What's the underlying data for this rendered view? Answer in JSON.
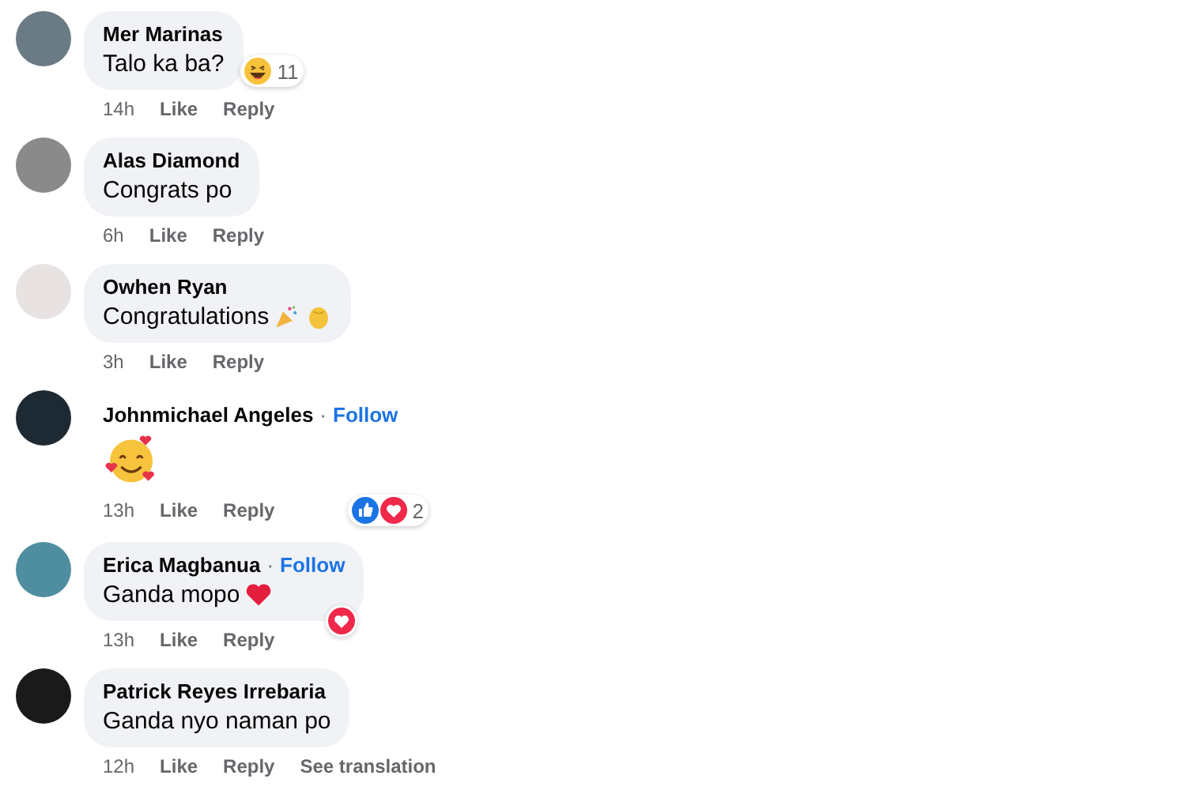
{
  "comments": [
    {
      "kind": "bubble",
      "name": "Mer Marinas",
      "text": "Talo ka ba?",
      "reactions": {
        "icons": [
          {
            "kind": "haha"
          }
        ],
        "count": "11",
        "kind": "corner-out"
      },
      "time": "14h",
      "actions": [
        "Like",
        "Reply"
      ]
    },
    {
      "kind": "bubble",
      "name": "Alas Diamond",
      "text": "Congrats po",
      "time": "6h",
      "actions": [
        "Like",
        "Reply"
      ]
    },
    {
      "kind": "bubble",
      "name": "Owhen Ryan",
      "text": "Congratulations",
      "emojis": [
        {
          "kind": "party"
        },
        {
          "kind": "clap"
        }
      ],
      "time": "3h",
      "actions": [
        "Like",
        "Reply"
      ]
    },
    {
      "kind": "emoji-only",
      "name": "Johnmichael Angeles",
      "follow": {
        "separator": "·",
        "label": "Follow"
      },
      "emojis": [
        {
          "kind": "hearts-face"
        }
      ],
      "reactions": {
        "icons": [
          {
            "kind": "like"
          },
          {
            "kind": "love"
          }
        ],
        "count": "2"
      },
      "time": "13h",
      "actions": [
        "Like",
        "Reply"
      ]
    },
    {
      "kind": "bubble",
      "name": "Erica Magbanua",
      "follow": {
        "separator": "·",
        "label": "Follow"
      },
      "text": "Ganda mopo",
      "emojis": [
        {
          "kind": "heart"
        }
      ],
      "reactions": {
        "icons": [
          {
            "kind": "love"
          }
        ],
        "kind": "corner-in"
      },
      "time": "13h",
      "actions": [
        "Like",
        "Reply"
      ]
    },
    {
      "kind": "bubble",
      "name": "Patrick Reyes Irrebaria",
      "text": "Ganda nyo naman po",
      "time": "12h",
      "actions": [
        "Like",
        "Reply",
        "See translation"
      ]
    }
  ]
}
